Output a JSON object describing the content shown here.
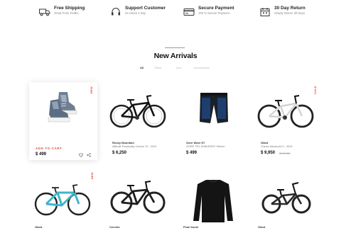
{
  "features": [
    {
      "title": "Free Shipping",
      "subtitle": "Great From FedEx",
      "icon": "truck-icon"
    },
    {
      "title": "Support Customer",
      "subtitle": "24 Hours A Day",
      "icon": "headset-icon"
    },
    {
      "title": "Secure Payment",
      "subtitle": "100 % Secure Payment",
      "icon": "card-icon"
    },
    {
      "title": "30 Day Return",
      "subtitle": "Simply Return 30 Days",
      "icon": "calendar-icon"
    }
  ],
  "section_title": "New Arrivals",
  "filters": [
    "All",
    "Bikes",
    "Tops",
    "Accessories"
  ],
  "featured": {
    "tag": "NEW",
    "add_to_cart": "ADD TO CART",
    "price": "$ 499",
    "image": "sneakers"
  },
  "products_row1": [
    {
      "brand": "Rocky Mountain",
      "name": "Altitude Powerplay Carbon 70 - 2019",
      "price": "$ 6,250",
      "old_price": "",
      "image": "mountain-bike"
    },
    {
      "brand": "Gore Wear ST",
      "name": "GORE TEX SHAKEDRY Stretch",
      "price": "$ 499",
      "old_price": "",
      "image": "shorts"
    },
    {
      "brand": "Giant",
      "name": "Trance Advanced 9 - 2019",
      "price": "$ 9,950",
      "old_price": "$ 10,450",
      "tag": "SALE",
      "image": "white-bike"
    }
  ],
  "products_row2": [
    {
      "brand": "Giant",
      "name": "",
      "price": "",
      "tag": "NEW",
      "image": "teal-bike"
    },
    {
      "brand": "Cervelo",
      "name": "",
      "price": "",
      "image": "mountain-bike-2"
    },
    {
      "brand": "Pearl Izumi",
      "name": "",
      "price": "",
      "image": "long-sleeve-jersey"
    },
    {
      "brand": "Giant",
      "name": "",
      "price": "",
      "image": "bmx-bike"
    }
  ],
  "colors": {
    "accent": "#e4483b",
    "teal": "#3fb5c9",
    "shorts_blue": "#1e3e6e"
  }
}
